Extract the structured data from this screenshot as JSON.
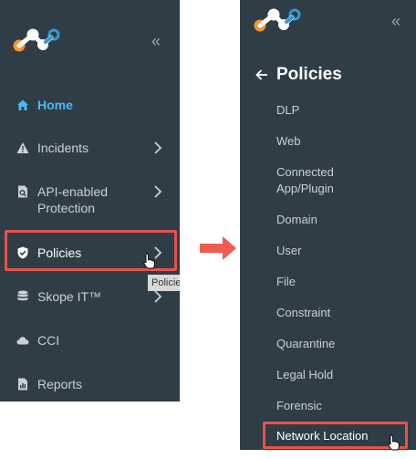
{
  "colors": {
    "panel_bg": "#2f3d46",
    "text": "#c9d1d6",
    "active_text": "#4fb7f0",
    "highlight": "#e8514a",
    "logo_orange": "#f5942a",
    "logo_blue": "#2f9ad6"
  },
  "left_nav": {
    "items": [
      {
        "label": "Home",
        "icon": "home-icon",
        "active": true
      },
      {
        "label": "Incidents",
        "icon": "warning-icon"
      },
      {
        "label": "API-enabled Protection",
        "icon": "document-search-icon"
      },
      {
        "label": "Policies",
        "icon": "shield-check-icon"
      },
      {
        "label": "Skope IT™",
        "icon": "database-icon"
      },
      {
        "label": "CCI",
        "icon": "cloud-icon"
      },
      {
        "label": "Reports",
        "icon": "report-icon"
      }
    ],
    "tooltip": "Policies"
  },
  "sub_menu": {
    "title": "Policies",
    "items": [
      "DLP",
      "Web",
      "Connected App/Plugin",
      "Domain",
      "User",
      "File",
      "Constraint",
      "Quarantine",
      "Legal Hold",
      "Forensic",
      "Network Location"
    ]
  }
}
